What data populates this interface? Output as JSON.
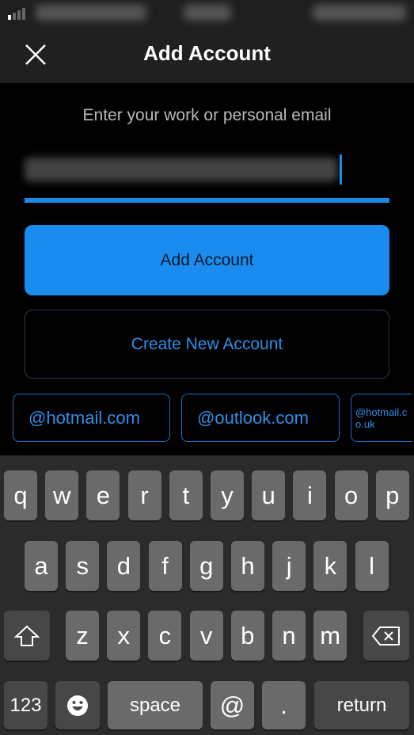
{
  "header": {
    "title": "Add Account",
    "close_icon": "close-icon"
  },
  "form": {
    "prompt": "Enter your work or personal email",
    "add_button": "Add Account",
    "create_button": "Create New Account"
  },
  "domain_chips": [
    "@hotmail.com",
    "@outlook.com",
    "@hotmail.co.uk"
  ],
  "colors": {
    "accent": "#1a8cf0",
    "background": "#000000",
    "header": "#202020"
  },
  "keyboard": {
    "row1": [
      "q",
      "w",
      "e",
      "r",
      "t",
      "y",
      "u",
      "i",
      "o",
      "p"
    ],
    "row2": [
      "a",
      "s",
      "d",
      "f",
      "g",
      "h",
      "j",
      "k",
      "l"
    ],
    "row3": [
      "z",
      "x",
      "c",
      "v",
      "b",
      "n",
      "m"
    ],
    "numbers": "123",
    "space": "space",
    "at": "@",
    "dot": ".",
    "return": "return"
  }
}
